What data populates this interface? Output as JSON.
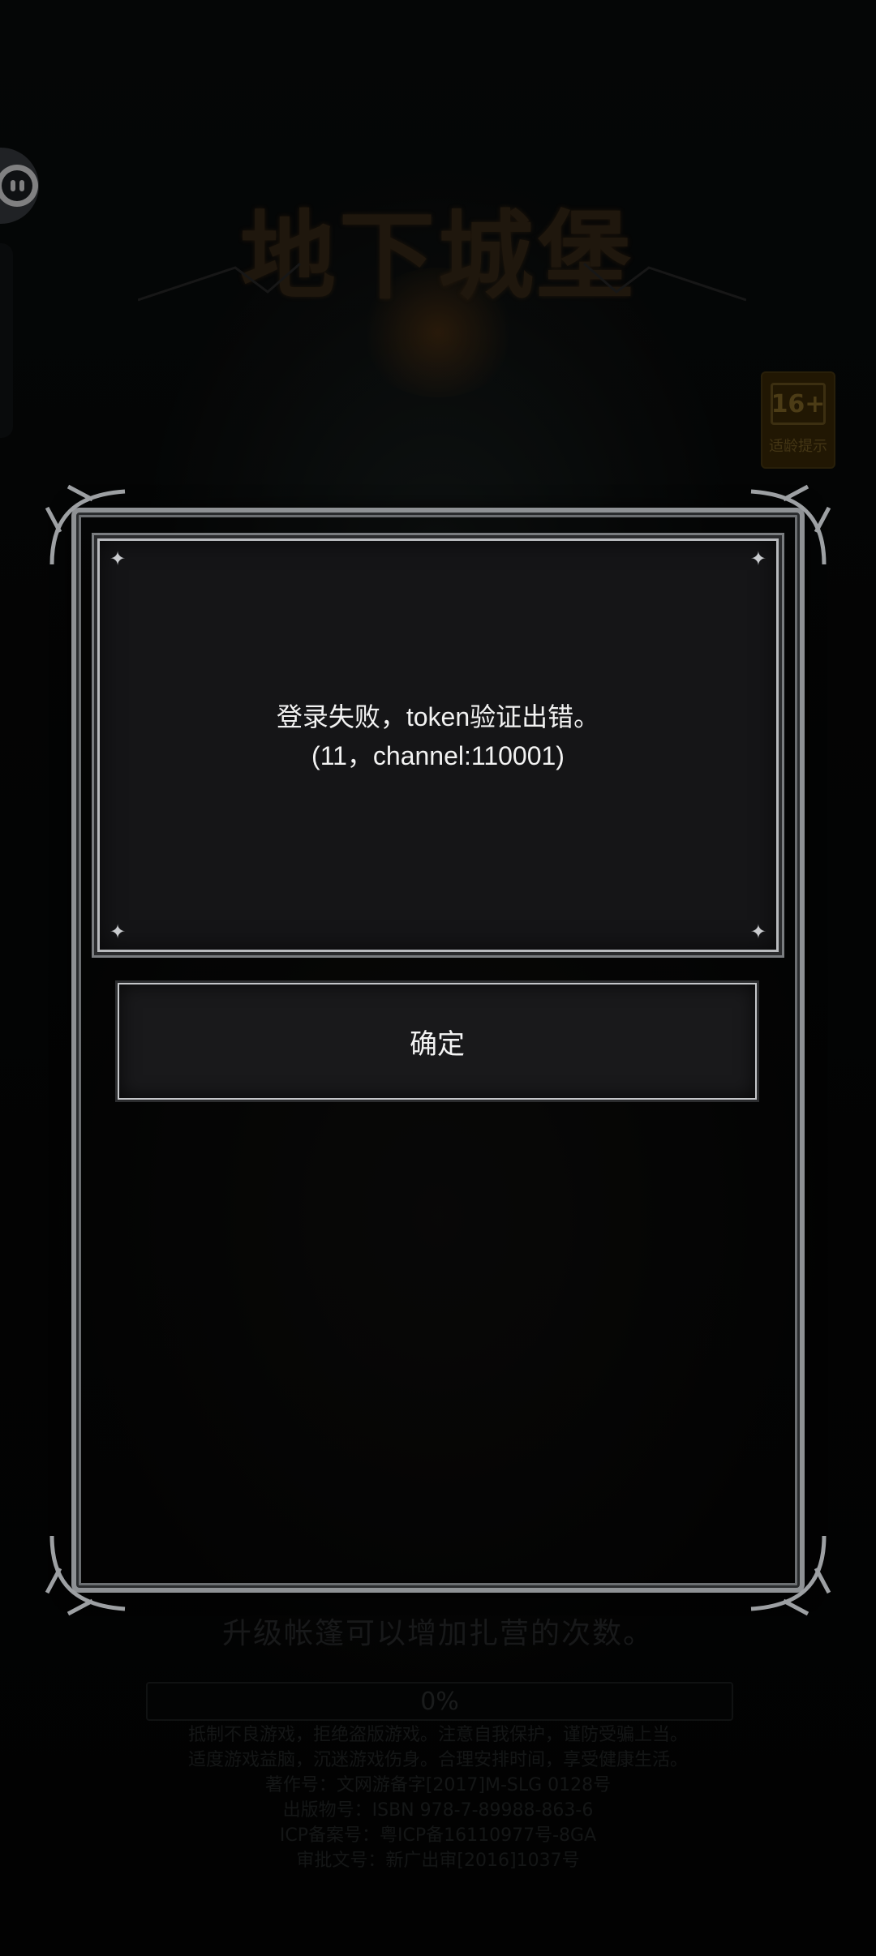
{
  "background": {
    "game_logo": "地下城堡",
    "age_rating": {
      "number": "16+",
      "caption": "适龄提示"
    },
    "loading_tip": "升级帐篷可以增加扎营的次数。",
    "progress": {
      "label": "0%",
      "value": 0
    },
    "notice_lines": [
      "抵制不良游戏，拒绝盗版游戏。注意自我保护，谨防受骗上当。",
      "适度游戏益脑，沉迷游戏伤身。合理安排时间，享受健康生活。",
      "著作号：文网游备字[2017]M-SLG 0128号",
      "出版物号：ISBN 978-7-89988-863-6",
      "ICP备案号：粤ICP备16110977号-8GA",
      "审批文号：新广出审[2016]1037号"
    ]
  },
  "dialog": {
    "message_line1": "登录失败，token验证出错。",
    "message_line2": "(11，channel:110001)",
    "confirm_label": "确定"
  },
  "icons": {
    "floating_assistant": "floating-assistant-icon",
    "corner_ornament": "ornament-icon",
    "sparkle": "sparkle-icon"
  }
}
